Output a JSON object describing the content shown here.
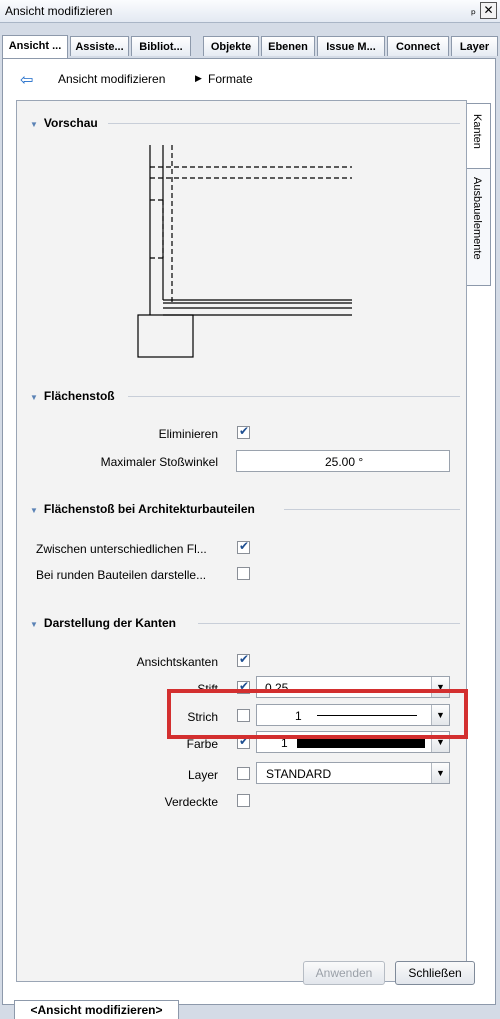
{
  "window": {
    "title": "Ansicht modifizieren",
    "pin": "ₚ",
    "close": "✕"
  },
  "tabs": [
    "Ansicht ...",
    "Assiste...",
    "Bibliot...",
    "Objekte",
    "Ebenen",
    "Issue M...",
    "Connect",
    "Layer"
  ],
  "breadcrumb": {
    "back": "⇦",
    "part1": "Ansicht modifizieren",
    "arrow": "▶",
    "part2": "Formate"
  },
  "side_tabs": [
    "Kanten",
    "Ausbauelemente"
  ],
  "sections": {
    "vorschau": "Vorschau",
    "flaechenstoss": "Flächenstoß",
    "architektur": "Flächenstoß bei Architekturbauteilen",
    "kanten": "Darstellung der Kanten"
  },
  "flaechenstoss": {
    "eliminieren_label": "Eliminieren",
    "eliminieren_checked": true,
    "winkel_label": "Maximaler Stoßwinkel",
    "winkel_value": "25.00 °"
  },
  "architektur": {
    "zwischen_label": "Zwischen unterschiedlichen Fl...",
    "zwischen_checked": true,
    "runden_label": "Bei runden Bauteilen darstelle...",
    "runden_checked": false
  },
  "kanten": {
    "ansicht_label": "Ansichtskanten",
    "ansicht_checked": true,
    "stift_label": "Stift",
    "stift_checked": true,
    "stift_value": "0.25",
    "strich_label": "Strich",
    "strich_checked": false,
    "strich_value": "1",
    "farbe_label": "Farbe",
    "farbe_checked": true,
    "farbe_value": "1",
    "farbe_swatch": "#000000",
    "layer_label": "Layer",
    "layer_checked": false,
    "layer_value": "STANDARD",
    "verdeckte_label": "Verdeckte",
    "verdeckte_checked": false
  },
  "buttons": {
    "apply": "Anwenden",
    "close": "Schließen"
  },
  "status_tab": "<Ansicht modifizieren>",
  "colors": {
    "highlight": "#d32f2f",
    "accent": "#1c6ac9"
  }
}
